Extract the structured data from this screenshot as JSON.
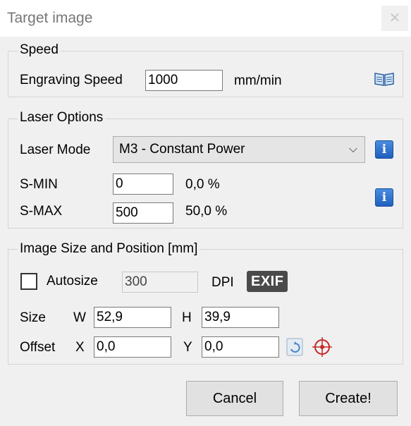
{
  "window": {
    "title": "Target image",
    "close_glyph": "✕"
  },
  "speed": {
    "group_title": "Speed",
    "engraving_speed_label": "Engraving Speed",
    "engraving_speed_value": "1000",
    "unit": "mm/min",
    "book_icon": "book-icon"
  },
  "laser_options": {
    "group_title": "Laser Options",
    "mode_label": "Laser Mode",
    "mode_value": "M3 - Constant Power",
    "mode_chevron": "⌵",
    "smin_label": "S-MIN",
    "smin_value": "0",
    "smin_percent": "0,0 %",
    "smax_label": "S-MAX",
    "smax_value": "500",
    "smax_percent": "50,0 %",
    "info_glyph": "i"
  },
  "image_size": {
    "group_title": "Image Size and Position [mm]",
    "autosize_label": "Autosize",
    "autosize_checked": false,
    "dpi_value": "300",
    "dpi_label": "DPI",
    "exif_label": "EXIF",
    "size_label": "Size",
    "w_label": "W",
    "w_value": "52,9",
    "h_label": "H",
    "h_value": "39,9",
    "offset_label": "Offset",
    "x_label": "X",
    "x_value": "0,0",
    "y_label": "Y",
    "y_value": "0,0"
  },
  "buttons": {
    "cancel": "Cancel",
    "create": "Create!"
  },
  "colors": {
    "info_blue": "#1f5fbf",
    "exif_bg": "#4a4a4a",
    "target_red": "#c62828"
  }
}
